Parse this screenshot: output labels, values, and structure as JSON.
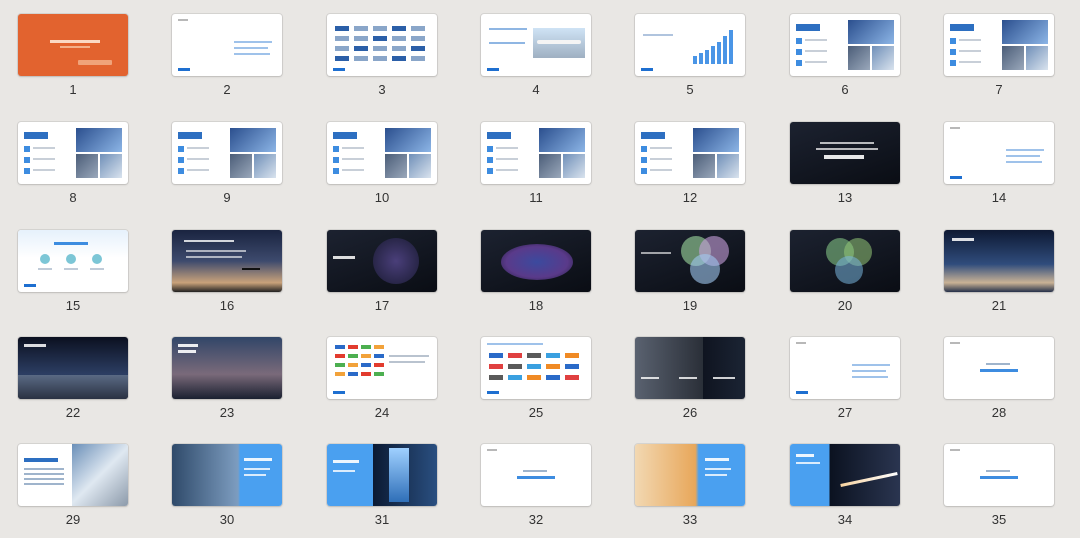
{
  "slides": [
    {
      "n": "1",
      "style": "orange"
    },
    {
      "n": "2",
      "style": "menu"
    },
    {
      "n": "3",
      "style": "logos"
    },
    {
      "n": "4",
      "style": "plane-card"
    },
    {
      "n": "5",
      "style": "barchart"
    },
    {
      "n": "6",
      "style": "photo-list"
    },
    {
      "n": "7",
      "style": "photo-list"
    },
    {
      "n": "8",
      "style": "photo-list"
    },
    {
      "n": "9",
      "style": "photo-list"
    },
    {
      "n": "10",
      "style": "photo-list"
    },
    {
      "n": "11",
      "style": "photo-list"
    },
    {
      "n": "12",
      "style": "photo-list"
    },
    {
      "n": "13",
      "style": "dark-text"
    },
    {
      "n": "14",
      "style": "menu"
    },
    {
      "n": "15",
      "style": "steps"
    },
    {
      "n": "16",
      "style": "plane-sky"
    },
    {
      "n": "17",
      "style": "dark-circle"
    },
    {
      "n": "18",
      "style": "dark-ellipse"
    },
    {
      "n": "19",
      "style": "dark-venn"
    },
    {
      "n": "20",
      "style": "dark-venn2"
    },
    {
      "n": "21",
      "style": "sky"
    },
    {
      "n": "22",
      "style": "space"
    },
    {
      "n": "23",
      "style": "dusk"
    },
    {
      "n": "24",
      "style": "brand-logos"
    },
    {
      "n": "25",
      "style": "brand-logos2"
    },
    {
      "n": "26",
      "style": "split-photo"
    },
    {
      "n": "27",
      "style": "menu"
    },
    {
      "n": "28",
      "style": "center-text"
    },
    {
      "n": "29",
      "style": "text-photo"
    },
    {
      "n": "30",
      "style": "blue-photo"
    },
    {
      "n": "31",
      "style": "water-blue"
    },
    {
      "n": "32",
      "style": "center-text"
    },
    {
      "n": "33",
      "style": "sunset-blue"
    },
    {
      "n": "34",
      "style": "blue-road"
    },
    {
      "n": "35",
      "style": "center-text"
    }
  ]
}
